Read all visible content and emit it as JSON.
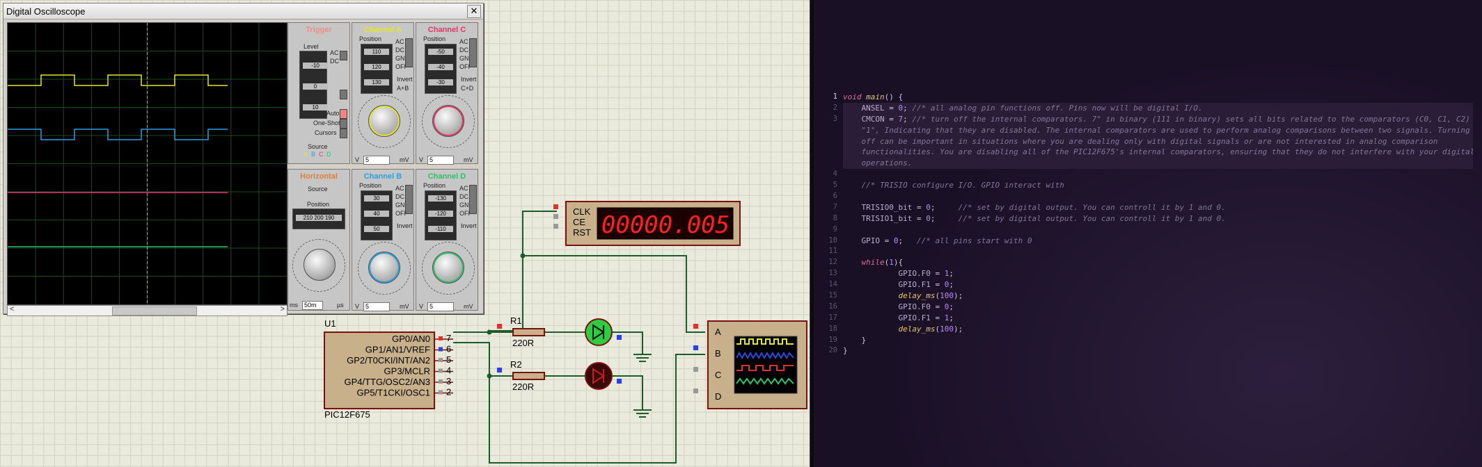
{
  "oscilloscope": {
    "title": "Digital Oscilloscope",
    "close_label": "✕",
    "scroll_left": "<",
    "scroll_right": ">",
    "trigger": {
      "title": "Trigger",
      "level_label": "Level",
      "level_values": [
        "-10",
        "0",
        "10"
      ],
      "ac": "AC",
      "dc": "DC",
      "auto": "Auto",
      "one_shot": "One-Shot",
      "cursors": "Cursors",
      "source_label": "Source",
      "sources": [
        "A",
        "B",
        "C",
        "D"
      ]
    },
    "channel_a": {
      "title": "Channel A",
      "position_label": "Position",
      "position_values": [
        "110",
        "120",
        "130"
      ],
      "modes": [
        "AC",
        "DC",
        "GND",
        "OFF"
      ],
      "invert": "Invert",
      "combine": "A+B",
      "volts_field": "5",
      "v_unit": "V",
      "mv_unit": "mV"
    },
    "channel_c": {
      "title": "Channel C",
      "position_label": "Position",
      "position_values": [
        "-50",
        "-40",
        "-30"
      ],
      "modes": [
        "AC",
        "DC",
        "GND",
        "OFF"
      ],
      "invert": "Invert",
      "combine": "C+D",
      "volts_field": "5",
      "v_unit": "V",
      "mv_unit": "mV"
    },
    "horizontal": {
      "title": "Horizontal",
      "source_label": "Source",
      "position_label": "Position",
      "position_values": [
        "210",
        "200",
        "190"
      ],
      "time_field": "50m",
      "ms_unit": "ms",
      "us_unit": "µs"
    },
    "channel_b": {
      "title": "Channel B",
      "position_label": "Position",
      "position_values": [
        "30",
        "40",
        "50"
      ],
      "modes": [
        "AC",
        "DC",
        "GND",
        "OFF"
      ],
      "invert": "Invert",
      "volts_field": "5",
      "v_unit": "V",
      "mv_unit": "mV"
    },
    "channel_d": {
      "title": "Channel D",
      "position_label": "Position",
      "position_values": [
        "-130",
        "-120",
        "-110"
      ],
      "modes": [
        "AC",
        "DC",
        "GND",
        "OFF"
      ],
      "invert": "Invert",
      "volts_field": "5",
      "v_unit": "V",
      "mv_unit": "mV"
    }
  },
  "schematic": {
    "mcu": {
      "ref": "U1",
      "part": "PIC12F675",
      "pins": [
        {
          "name": "GP0/AN0",
          "num": "7"
        },
        {
          "name": "GP1/AN1/VREF",
          "num": "6"
        },
        {
          "name": "GP2/T0CKI/INT/AN2",
          "num": "5"
        },
        {
          "name": "GP3/MCLR",
          "num": "4"
        },
        {
          "name": "GP4/TTG/OSC2/AN3",
          "num": "3"
        },
        {
          "name": "GP5/T1CKI/OSC1",
          "num": "2"
        }
      ]
    },
    "r1": {
      "ref": "R1",
      "value": "220R"
    },
    "r2": {
      "ref": "R2",
      "value": "220R"
    },
    "counter": {
      "pins": [
        "CLK",
        "CE",
        "RST"
      ],
      "display": "00000.005"
    },
    "scope_inputs": [
      "A",
      "B",
      "C",
      "D"
    ]
  },
  "editor": {
    "lines": [
      {
        "n": "1",
        "tokens": [
          [
            "kw",
            "void "
          ],
          [
            "fn",
            "main"
          ],
          [
            "sym",
            "() {"
          ]
        ]
      },
      {
        "n": "2",
        "tokens": [
          [
            "id",
            "    ANSEL "
          ],
          [
            "sym",
            "= "
          ],
          [
            "num",
            "0"
          ],
          [
            "sym",
            "; "
          ],
          [
            "cm",
            "//* all analog pin functions off. Pins now will be digital I/O."
          ]
        ]
      },
      {
        "n": "3",
        "tokens": [
          [
            "id",
            "    CMCON "
          ],
          [
            "sym",
            "= "
          ],
          [
            "num",
            "7"
          ],
          [
            "sym",
            "; "
          ],
          [
            "cm",
            "//* turn off the internal comparators. 7\" in binary (111 in binary) sets all bits related to the comparators (C0, C1, C2) to"
          ]
        ]
      },
      {
        "n": "",
        "tokens": [
          [
            "cm",
            "    \"1\", Indicating that they are disabled. The internal comparators are used to perform analog comparisons between two signals. Turning them"
          ]
        ]
      },
      {
        "n": "",
        "tokens": [
          [
            "cm",
            "    off can be important in situations where you are dealing only with digital signals or are not interested in analog comparison"
          ]
        ]
      },
      {
        "n": "",
        "tokens": [
          [
            "cm",
            "    functionalities. You are disabling all of the PIC12F675's internal comparators, ensuring that they do not interfere with your digital"
          ]
        ]
      },
      {
        "n": "",
        "tokens": [
          [
            "cm",
            "    operations."
          ]
        ]
      },
      {
        "n": "4",
        "tokens": []
      },
      {
        "n": "5",
        "tokens": [
          [
            "cm",
            "    //* TRISIO configure I/O. GPIO interact with"
          ]
        ]
      },
      {
        "n": "6",
        "tokens": []
      },
      {
        "n": "7",
        "tokens": [
          [
            "id",
            "    TRISIO0_bit "
          ],
          [
            "sym",
            "= "
          ],
          [
            "num",
            "0"
          ],
          [
            "sym",
            ";     "
          ],
          [
            "cm",
            "//* set by digital output. You can controll it by 1 and 0."
          ]
        ]
      },
      {
        "n": "8",
        "tokens": [
          [
            "id",
            "    TRISIO1_bit "
          ],
          [
            "sym",
            "= "
          ],
          [
            "num",
            "0"
          ],
          [
            "sym",
            ";     "
          ],
          [
            "cm",
            "//* set by digital output. You can controll it by 1 and 0."
          ]
        ]
      },
      {
        "n": "9",
        "tokens": []
      },
      {
        "n": "10",
        "tokens": [
          [
            "id",
            "    GPIO "
          ],
          [
            "sym",
            "= "
          ],
          [
            "num",
            "0"
          ],
          [
            "sym",
            ";   "
          ],
          [
            "cm",
            "//* all pins start with 0"
          ]
        ]
      },
      {
        "n": "11",
        "tokens": []
      },
      {
        "n": "12",
        "tokens": [
          [
            "kw",
            "    while"
          ],
          [
            "sym",
            "("
          ],
          [
            "num",
            "1"
          ],
          [
            "sym",
            "){"
          ]
        ]
      },
      {
        "n": "13",
        "tokens": [
          [
            "id",
            "            GPIO.F0 "
          ],
          [
            "sym",
            "= "
          ],
          [
            "num",
            "1"
          ],
          [
            "sym",
            ";"
          ]
        ]
      },
      {
        "n": "14",
        "tokens": [
          [
            "id",
            "            GPIO.F1 "
          ],
          [
            "sym",
            "= "
          ],
          [
            "num",
            "0"
          ],
          [
            "sym",
            ";"
          ]
        ]
      },
      {
        "n": "15",
        "tokens": [
          [
            "fn",
            "            delay_ms"
          ],
          [
            "sym",
            "("
          ],
          [
            "num",
            "100"
          ],
          [
            "sym",
            ");"
          ]
        ]
      },
      {
        "n": "16",
        "tokens": [
          [
            "id",
            "            GPIO.F0 "
          ],
          [
            "sym",
            "= "
          ],
          [
            "num",
            "0"
          ],
          [
            "sym",
            ";"
          ]
        ]
      },
      {
        "n": "17",
        "tokens": [
          [
            "id",
            "            GPIO.F1 "
          ],
          [
            "sym",
            "= "
          ],
          [
            "num",
            "1"
          ],
          [
            "sym",
            ";"
          ]
        ]
      },
      {
        "n": "18",
        "tokens": [
          [
            "fn",
            "            delay_ms"
          ],
          [
            "sym",
            "("
          ],
          [
            "num",
            "100"
          ],
          [
            "sym",
            ");"
          ]
        ]
      },
      {
        "n": "19",
        "tokens": [
          [
            "sym",
            "    }"
          ]
        ]
      },
      {
        "n": "20",
        "tokens": [
          [
            "sym",
            "}"
          ]
        ]
      }
    ]
  },
  "colors": {
    "channel_a": "#e6e62a",
    "channel_b": "#2aa0e0",
    "channel_c": "#e0386a",
    "channel_d": "#2ec06a",
    "wire": "#1a5c2a"
  }
}
